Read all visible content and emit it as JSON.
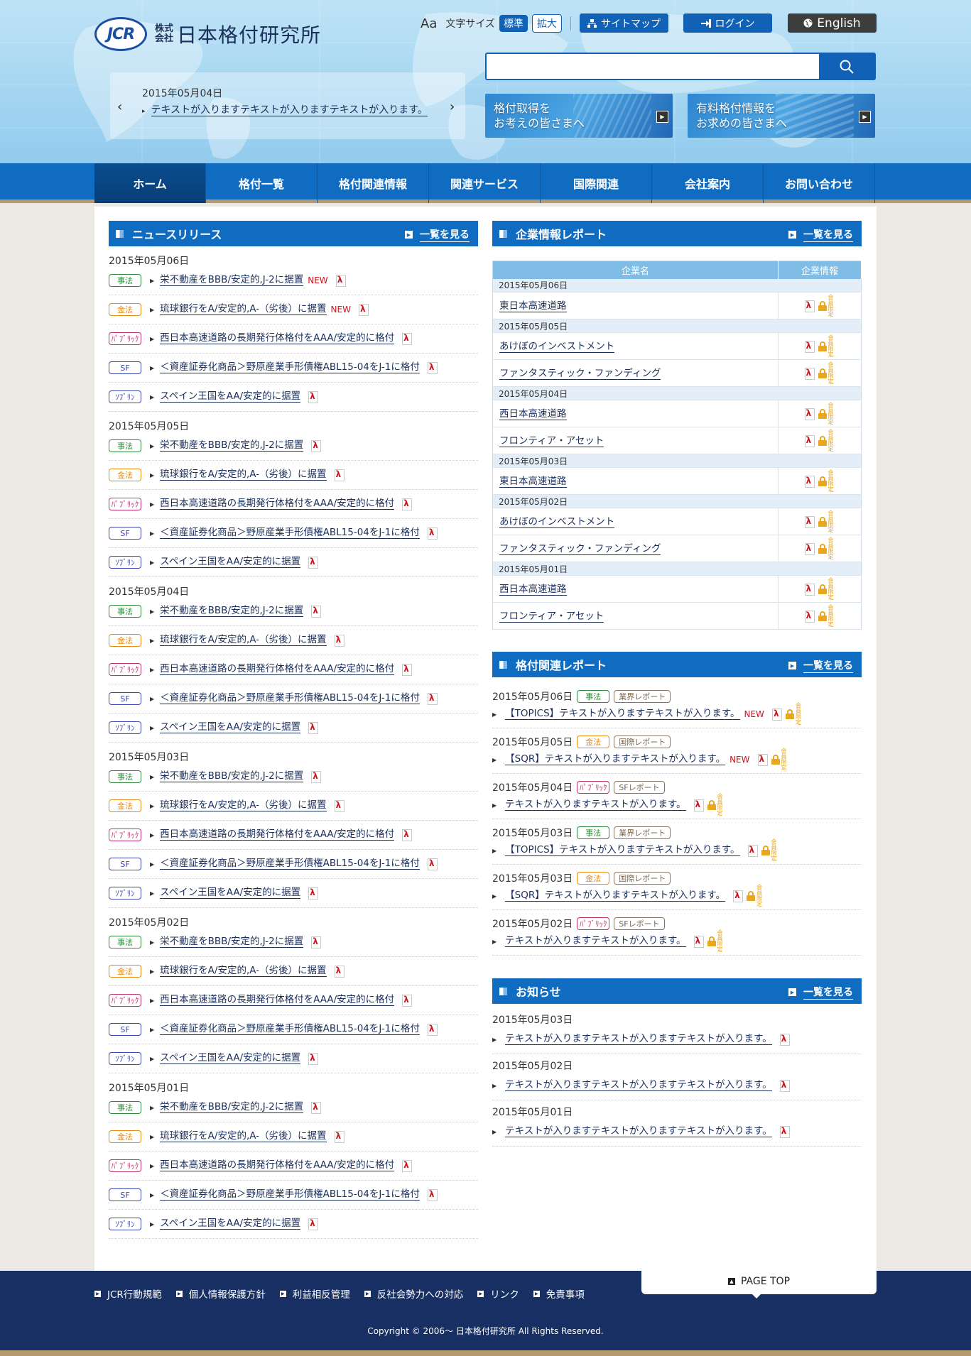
{
  "header": {
    "logo_mark": "JCR",
    "logo_kabushiki": "株式会社",
    "company_name": "日本格付研究所",
    "font_icon": "Aa",
    "font_size_label": "文字サイズ",
    "font_standard": "標準",
    "font_large": "拡大",
    "sitemap": "サイトマップ",
    "login": "ログイン",
    "english": "English",
    "search_placeholder": "",
    "ticker_date": "2015年05月04日",
    "ticker_text": "テキストが入りますテキストが入りますテキストが入ります。",
    "banner1_line1": "格付取得を",
    "banner1_line2": "お考えの皆さまへ",
    "banner2_line1": "有料格付情報を",
    "banner2_line2": "お求めの皆さまへ"
  },
  "nav": [
    "ホーム",
    "格付一覧",
    "格付関連情報",
    "関連サービス",
    "国際関連",
    "会社案内",
    "お問い合わせ"
  ],
  "news": {
    "title": "ニュースリリース",
    "more": "一覧を見る",
    "groups": [
      {
        "date": "2015年05月06日",
        "items": [
          {
            "tag": "事法",
            "cls": "g",
            "text": "栄不動産をBBB/安定的,J-2に据置",
            "new": "NEW"
          },
          {
            "tag": "金法",
            "cls": "o",
            "text": "琉球銀行をA/安定的,A-（劣後）に据置",
            "new": "NEW"
          },
          {
            "tag": "ﾊﾟﾌﾞﾘｯｸ",
            "cls": "m",
            "text": "西日本高速道路の長期発行体格付をAAA/安定的に格付",
            "new": ""
          },
          {
            "tag": "SF",
            "cls": "p",
            "text": "＜資産証券化商品＞野原産業手形債権ABL15-04をJ-1に格付",
            "new": ""
          },
          {
            "tag": "ｿﾌﾞﾘﾝ",
            "cls": "p",
            "text": "スペイン王国をAA/安定的に据置",
            "new": ""
          }
        ]
      },
      {
        "date": "2015年05月05日",
        "items": [
          {
            "tag": "事法",
            "cls": "g",
            "text": "栄不動産をBBB/安定的,J-2に据置",
            "new": ""
          },
          {
            "tag": "金法",
            "cls": "o",
            "text": "琉球銀行をA/安定的,A-（劣後）に据置",
            "new": ""
          },
          {
            "tag": "ﾊﾟﾌﾞﾘｯｸ",
            "cls": "m",
            "text": "西日本高速道路の長期発行体格付をAAA/安定的に格付",
            "new": ""
          },
          {
            "tag": "SF",
            "cls": "p",
            "text": "＜資産証券化商品＞野原産業手形債権ABL15-04をJ-1に格付",
            "new": ""
          },
          {
            "tag": "ｿﾌﾞﾘﾝ",
            "cls": "p",
            "text": "スペイン王国をAA/安定的に据置",
            "new": ""
          }
        ]
      },
      {
        "date": "2015年05月04日",
        "items": [
          {
            "tag": "事法",
            "cls": "g",
            "text": "栄不動産をBBB/安定的,J-2に据置",
            "new": ""
          },
          {
            "tag": "金法",
            "cls": "o",
            "text": "琉球銀行をA/安定的,A-（劣後）に据置",
            "new": ""
          },
          {
            "tag": "ﾊﾟﾌﾞﾘｯｸ",
            "cls": "m",
            "text": "西日本高速道路の長期発行体格付をAAA/安定的に格付",
            "new": ""
          },
          {
            "tag": "SF",
            "cls": "p",
            "text": "＜資産証券化商品＞野原産業手形債権ABL15-04をJ-1に格付",
            "new": ""
          },
          {
            "tag": "ｿﾌﾞﾘﾝ",
            "cls": "p",
            "text": "スペイン王国をAA/安定的に据置",
            "new": ""
          }
        ]
      },
      {
        "date": "2015年05月03日",
        "items": [
          {
            "tag": "事法",
            "cls": "g",
            "text": "栄不動産をBBB/安定的,J-2に据置",
            "new": ""
          },
          {
            "tag": "金法",
            "cls": "o",
            "text": "琉球銀行をA/安定的,A-（劣後）に据置",
            "new": ""
          },
          {
            "tag": "ﾊﾟﾌﾞﾘｯｸ",
            "cls": "m",
            "text": "西日本高速道路の長期発行体格付をAAA/安定的に格付",
            "new": ""
          },
          {
            "tag": "SF",
            "cls": "p",
            "text": "＜資産証券化商品＞野原産業手形債権ABL15-04をJ-1に格付",
            "new": ""
          },
          {
            "tag": "ｿﾌﾞﾘﾝ",
            "cls": "p",
            "text": "スペイン王国をAA/安定的に据置",
            "new": ""
          }
        ]
      },
      {
        "date": "2015年05月02日",
        "items": [
          {
            "tag": "事法",
            "cls": "g",
            "text": "栄不動産をBBB/安定的,J-2に据置",
            "new": ""
          },
          {
            "tag": "金法",
            "cls": "o",
            "text": "琉球銀行をA/安定的,A-（劣後）に据置",
            "new": ""
          },
          {
            "tag": "ﾊﾟﾌﾞﾘｯｸ",
            "cls": "m",
            "text": "西日本高速道路の長期発行体格付をAAA/安定的に格付",
            "new": ""
          },
          {
            "tag": "SF",
            "cls": "p",
            "text": "＜資産証券化商品＞野原産業手形債権ABL15-04をJ-1に格付",
            "new": ""
          },
          {
            "tag": "ｿﾌﾞﾘﾝ",
            "cls": "p",
            "text": "スペイン王国をAA/安定的に据置",
            "new": ""
          }
        ]
      },
      {
        "date": "2015年05月01日",
        "items": [
          {
            "tag": "事法",
            "cls": "g",
            "text": "栄不動産をBBB/安定的,J-2に据置",
            "new": ""
          },
          {
            "tag": "金法",
            "cls": "o",
            "text": "琉球銀行をA/安定的,A-（劣後）に据置",
            "new": ""
          },
          {
            "tag": "ﾊﾟﾌﾞﾘｯｸ",
            "cls": "m",
            "text": "西日本高速道路の長期発行体格付をAAA/安定的に格付",
            "new": ""
          },
          {
            "tag": "SF",
            "cls": "p",
            "text": "＜資産証券化商品＞野原産業手形債権ABL15-04をJ-1に格付",
            "new": ""
          },
          {
            "tag": "ｿﾌﾞﾘﾝ",
            "cls": "p",
            "text": "スペイン王国をAA/安定的に据置",
            "new": ""
          }
        ]
      }
    ]
  },
  "company_report": {
    "title": "企業情報レポート",
    "more": "一覧を見る",
    "col_name": "企業名",
    "col_info": "企業情報",
    "lock_label": "会員限定",
    "groups": [
      {
        "date": "2015年05月06日",
        "items": [
          "東日本高速道路"
        ]
      },
      {
        "date": "2015年05月05日",
        "items": [
          "あけぼのインベストメント",
          "ファンタスティック・ファンディング"
        ]
      },
      {
        "date": "2015年05月04日",
        "items": [
          "西日本高速道路",
          "フロンティア・アセット"
        ]
      },
      {
        "date": "2015年05月03日",
        "items": [
          "東日本高速道路"
        ]
      },
      {
        "date": "2015年05月02日",
        "items": [
          "あけぼのインベストメント",
          "ファンタスティック・ファンディング"
        ]
      },
      {
        "date": "2015年05月01日",
        "items": [
          "西日本高速道路",
          "フロンティア・アセット"
        ]
      }
    ]
  },
  "rating_report": {
    "title": "格付関連レポート",
    "more": "一覧を見る",
    "lock_label": "会員限定",
    "items": [
      {
        "date": "2015年05月06日",
        "tag": "事法",
        "cls": "g",
        "type": "業界レポート",
        "text": "【TOPICS】テキストが入りますテキストが入ります。",
        "new": "NEW"
      },
      {
        "date": "2015年05月05日",
        "tag": "金法",
        "cls": "o",
        "type": "国際レポート",
        "text": "【SQR】テキストが入りますテキストが入ります。",
        "new": "NEW"
      },
      {
        "date": "2015年05月04日",
        "tag": "ﾊﾟﾌﾞﾘｯｸ",
        "cls": "m",
        "type": "SFレポート",
        "text": "テキストが入りますテキストが入ります。",
        "new": ""
      },
      {
        "date": "2015年05月03日",
        "tag": "事法",
        "cls": "g",
        "type": "業界レポート",
        "text": "【TOPICS】テキストが入りますテキストが入ります。",
        "new": ""
      },
      {
        "date": "2015年05月03日",
        "tag": "金法",
        "cls": "o",
        "type": "国際レポート",
        "text": "【SQR】テキストが入りますテキストが入ります。",
        "new": ""
      },
      {
        "date": "2015年05月02日",
        "tag": "ﾊﾟﾌﾞﾘｯｸ",
        "cls": "m",
        "type": "SFレポート",
        "text": "テキストが入りますテキストが入ります。",
        "new": ""
      }
    ]
  },
  "notices": {
    "title": "お知らせ",
    "more": "一覧を見る",
    "items": [
      {
        "date": "2015年05月03日",
        "text": "テキストが入りますテキストが入りますテキストが入ります。"
      },
      {
        "date": "2015年05月02日",
        "text": "テキストが入りますテキストが入りますテキストが入ります。"
      },
      {
        "date": "2015年05月01日",
        "text": "テキストが入りますテキストが入りますテキストが入ります。"
      }
    ]
  },
  "footer": {
    "links": [
      "JCR行動規範",
      "個人情報保護方針",
      "利益相反管理",
      "反社会勢力への対応",
      "リンク",
      "免責事項"
    ],
    "page_top": "PAGE TOP",
    "copyright": "Copyright © 2006〜 日本格付研究所 All Rights Reserved."
  },
  "colors": {
    "primary": "#0f6cc1",
    "footer": "#172f63",
    "accent": "#b59a6d",
    "new": "#d0121b",
    "lock": "#e9a61e"
  }
}
